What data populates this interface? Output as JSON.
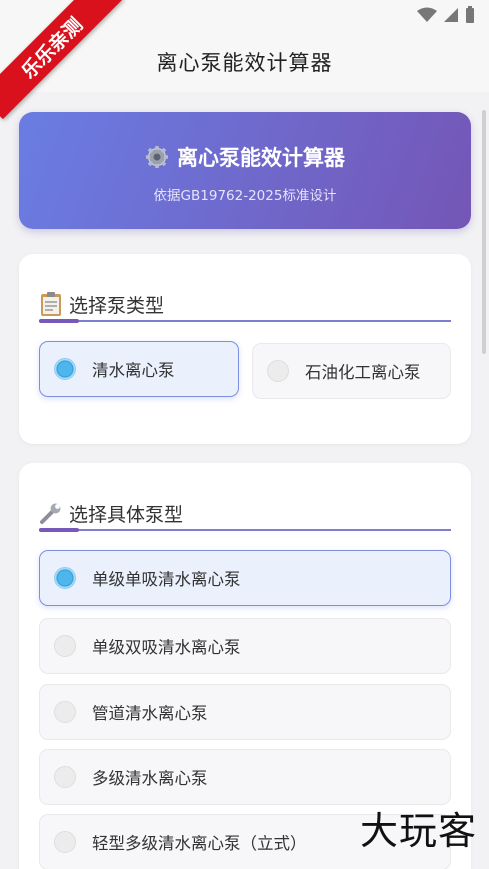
{
  "ribbon": {
    "text": "乐乐亲测"
  },
  "app_bar": {
    "title": "离心泵能效计算器",
    "back_icon": "chevron-left-icon"
  },
  "hero": {
    "icon": "gear-icon",
    "title": "离心泵能效计算器",
    "subtitle": "依据GB19762-2025标准设计",
    "gradient_start": "#6a7de3",
    "gradient_end": "#7456b6"
  },
  "section1": {
    "icon": "clipboard-icon",
    "title": "选择泵类型",
    "options": [
      {
        "label": "清水离心泵",
        "selected": true
      },
      {
        "label": "石油化工离心泵",
        "selected": false
      }
    ]
  },
  "section2": {
    "icon": "wrench-icon",
    "title": "选择具体泵型",
    "options": [
      {
        "label": "单级单吸清水离心泵",
        "selected": true
      },
      {
        "label": "单级双吸清水离心泵",
        "selected": false
      },
      {
        "label": "管道清水离心泵",
        "selected": false
      },
      {
        "label": "多级清水离心泵",
        "selected": false
      },
      {
        "label": "轻型多级清水离心泵（立式）",
        "selected": false
      }
    ]
  },
  "watermark": {
    "text": "大玩客"
  }
}
